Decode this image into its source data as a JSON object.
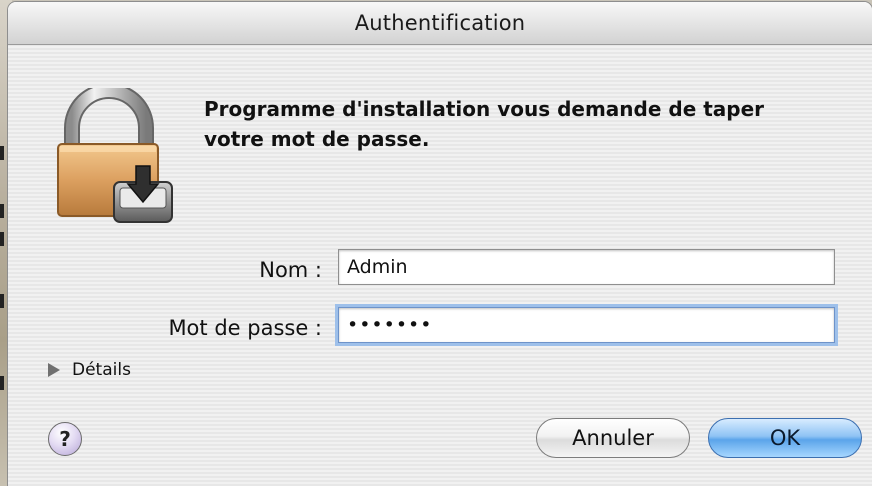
{
  "window": {
    "title": "Authentification"
  },
  "message": {
    "line1": "Programme d'installation vous demande de taper",
    "line2": "votre mot de passe."
  },
  "form": {
    "name_label": "Nom :",
    "name_value": "Admin",
    "password_label": "Mot de passe :",
    "password_value": "•••••••"
  },
  "details": {
    "label": "Détails"
  },
  "buttons": {
    "help": "?",
    "cancel": "Annuler",
    "ok": "OK"
  },
  "icons": {
    "lock": "lock-install-icon",
    "disclosure": "disclosure-triangle-icon"
  },
  "colors": {
    "ok_accent": "#5ba4ea",
    "focus_ring": "#9ec0ea"
  }
}
